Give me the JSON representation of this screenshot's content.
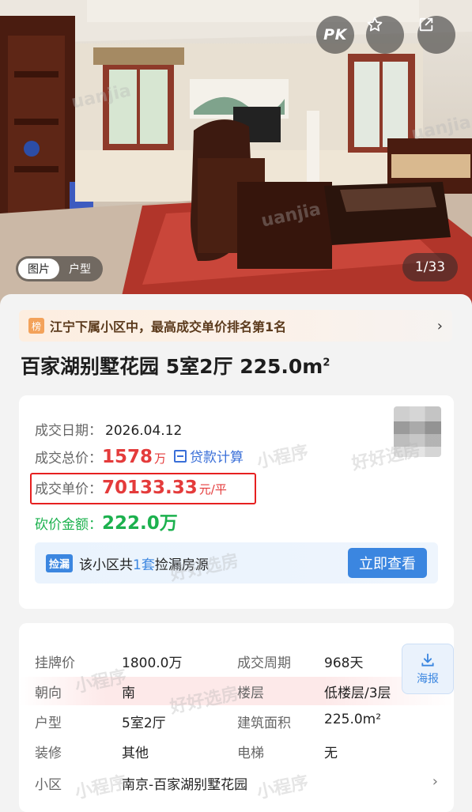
{
  "hero": {
    "pk_label": "PK",
    "media_tabs": [
      "图片",
      "户型"
    ],
    "counter": "1/33",
    "watermark": "uanjia"
  },
  "rank_banner": {
    "badge": "榜",
    "text": "江宁下属小区中，最高成交单价排名第1名"
  },
  "title": {
    "main": "百家湖别墅花园 5室2厅 225.0m",
    "sup": "2"
  },
  "deal": {
    "date_label": "成交日期：",
    "date_value": "2026.04.12",
    "total_label": "成交总价：",
    "total_value": "1578",
    "total_unit": "万",
    "loan_link": "贷款计算",
    "unit_label": "成交单价：",
    "unit_value": "70133.33",
    "unit_unit": "元/平",
    "cut_label": "砍价金额：",
    "cut_value": "222.0万"
  },
  "leak": {
    "tag": "捡漏",
    "text_prefix": "该小区共",
    "count": "1套",
    "text_suffix": "捡漏房源",
    "button": "立即查看"
  },
  "info": {
    "rows": [
      {
        "k1": "挂牌价",
        "v1": "1800.0万",
        "k2": "成交周期",
        "v2": "968天"
      },
      {
        "k1": "朝向",
        "v1": "南",
        "k2": "楼层",
        "v2": "低楼层/3层"
      },
      {
        "k1": "户型",
        "v1": "5室2厅",
        "k2": "建筑面积",
        "v2": "225.0m²"
      },
      {
        "k1": "装修",
        "v1": "其他",
        "k2": "电梯",
        "v2": "无"
      }
    ],
    "community_label": "小区",
    "community_value": "南京-百家湖别墅花园",
    "poster_label": "海报"
  },
  "watermarks": [
    "好好选房",
    "小程序"
  ],
  "colors": {
    "price_red": "#e43b3b",
    "cut_green": "#1cb14e",
    "accent_blue": "#3b86e0",
    "highlight_border": "#e62020"
  }
}
